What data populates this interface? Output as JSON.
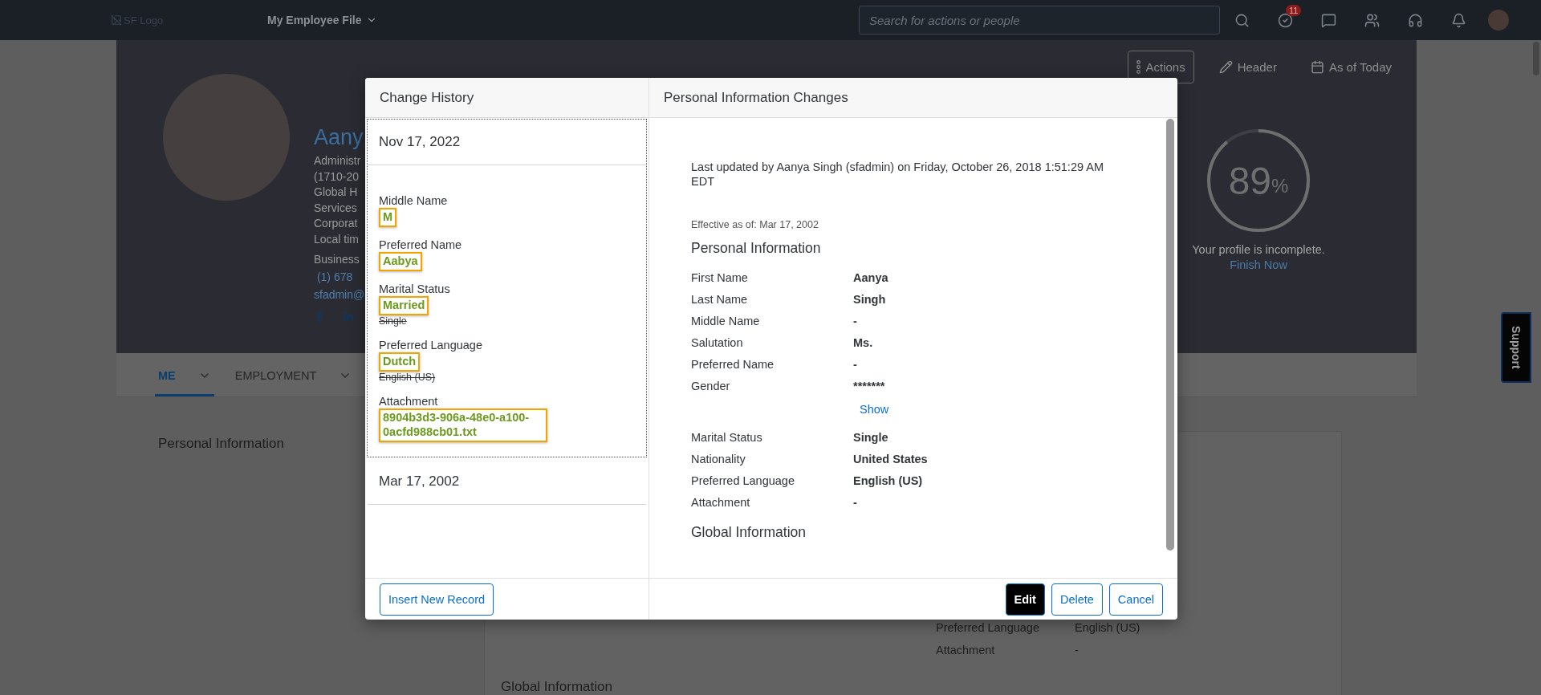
{
  "top_bar": {
    "logo_alt": "SF Logo",
    "app_menu": "My Employee File",
    "search": {
      "placeholder": "Search for actions or people"
    },
    "todo_badge": "11"
  },
  "profile": {
    "name": "Aany",
    "lines": [
      "Administr",
      "(1710-20",
      "Global H",
      "Services",
      "Corporat",
      "Local tim"
    ],
    "business_label": "Business",
    "phone": "(1) 678",
    "email": "sfadmin@"
  },
  "header_actions": [
    {
      "kind": "more",
      "label": "Actions"
    },
    {
      "kind": "edit",
      "label": "Header"
    },
    {
      "kind": "date",
      "label": "As of Today"
    }
  ],
  "completion": {
    "percent": "89",
    "unit": "%",
    "level": 0.89,
    "message": "Your profile is incomplete.",
    "link": "Finish Now"
  },
  "tabs": [
    {
      "label": "ME",
      "selected": true
    },
    {
      "label": "EMPLOYMENT",
      "selected": false
    }
  ],
  "section_title": "Personal Information",
  "background_card": {
    "rows": [
      {
        "label": "Preferred Language",
        "value": "English (US)"
      },
      {
        "label": "Attachment",
        "value": "-"
      }
    ],
    "next_section": "Global Information"
  },
  "support_tab": "Support",
  "dialog": {
    "history_title": "Change History",
    "records": [
      {
        "date": "Nov 17, 2022",
        "expanded": true,
        "changes": [
          {
            "label": "Middle Name",
            "new_value": "M"
          },
          {
            "label": "Preferred Name",
            "new_value": "Aabya"
          },
          {
            "label": "Marital Status",
            "new_value": "Married",
            "old_value": "Single"
          },
          {
            "label": "Preferred Language",
            "new_value": "Dutch",
            "old_value": "English (US)"
          },
          {
            "label": "Attachment",
            "new_value": "8904b3d3-906a-48e0-a100-0acfd988cb01.txt"
          }
        ]
      },
      {
        "date": "Mar 17, 2002",
        "expanded": false
      }
    ],
    "insert_button": "Insert New Record",
    "detail_title": "Personal Information Changes",
    "last_updated": "Last updated by Aanya Singh (sfadmin) on Friday, October 26, 2018 1:51:29 AM EDT",
    "effective": "Effective as of: Mar 17, 2002",
    "section_title": "Personal Information",
    "rows": [
      {
        "kind": "field",
        "label": "First Name",
        "value": "Aanya"
      },
      {
        "kind": "field",
        "label": "Last Name",
        "value": "Singh"
      },
      {
        "kind": "field",
        "label": "Middle Name",
        "value": "-"
      },
      {
        "kind": "field",
        "label": "Salutation",
        "value": "Ms."
      },
      {
        "kind": "field",
        "label": "Preferred Name",
        "value": "-"
      },
      {
        "kind": "field",
        "label": "Gender",
        "value": "*******"
      },
      {
        "kind": "link",
        "label": "Show"
      },
      {
        "kind": "field",
        "label": "Marital Status",
        "value": "Single"
      },
      {
        "kind": "field",
        "label": "Nationality",
        "value": "United States"
      },
      {
        "kind": "field",
        "label": "Preferred Language",
        "value": "English (US)"
      },
      {
        "kind": "field",
        "label": "Attachment",
        "value": "-"
      }
    ],
    "next_section": "Global Information",
    "buttons": [
      {
        "kind": "primary",
        "label": "Edit"
      },
      {
        "kind": "secondary",
        "label": "Delete"
      },
      {
        "kind": "secondary",
        "label": "Cancel"
      }
    ]
  }
}
